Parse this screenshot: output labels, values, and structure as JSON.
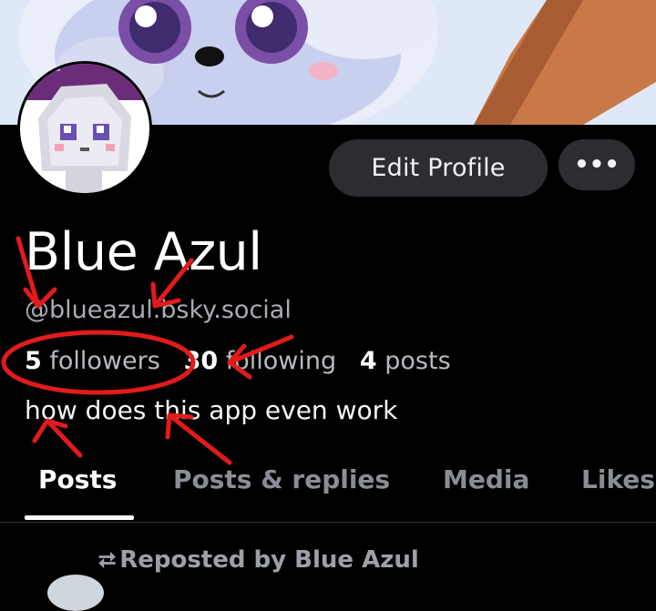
{
  "profile": {
    "name": "Blue Azul",
    "handle": "@blueazul.bsky.social",
    "followers_count": "5",
    "followers_label": "followers",
    "following_count": "30",
    "following_label": "following",
    "posts_count": "4",
    "posts_label": "posts",
    "bio": "how does this app even work"
  },
  "actions": {
    "edit_profile": "Edit Profile",
    "more": "•••"
  },
  "tabs": [
    {
      "label": "Posts",
      "active": true
    },
    {
      "label": "Posts & replies",
      "active": false
    },
    {
      "label": "Media",
      "active": false
    },
    {
      "label": "Likes",
      "active": false
    }
  ],
  "feed": {
    "repost_icon": "⮂",
    "repost_label": "Reposted by Blue Azul"
  },
  "colors": {
    "background": "#000000",
    "button": "#2b2d31",
    "muted_text": "#a9acb3",
    "annotation_red": "#e11b1b"
  }
}
